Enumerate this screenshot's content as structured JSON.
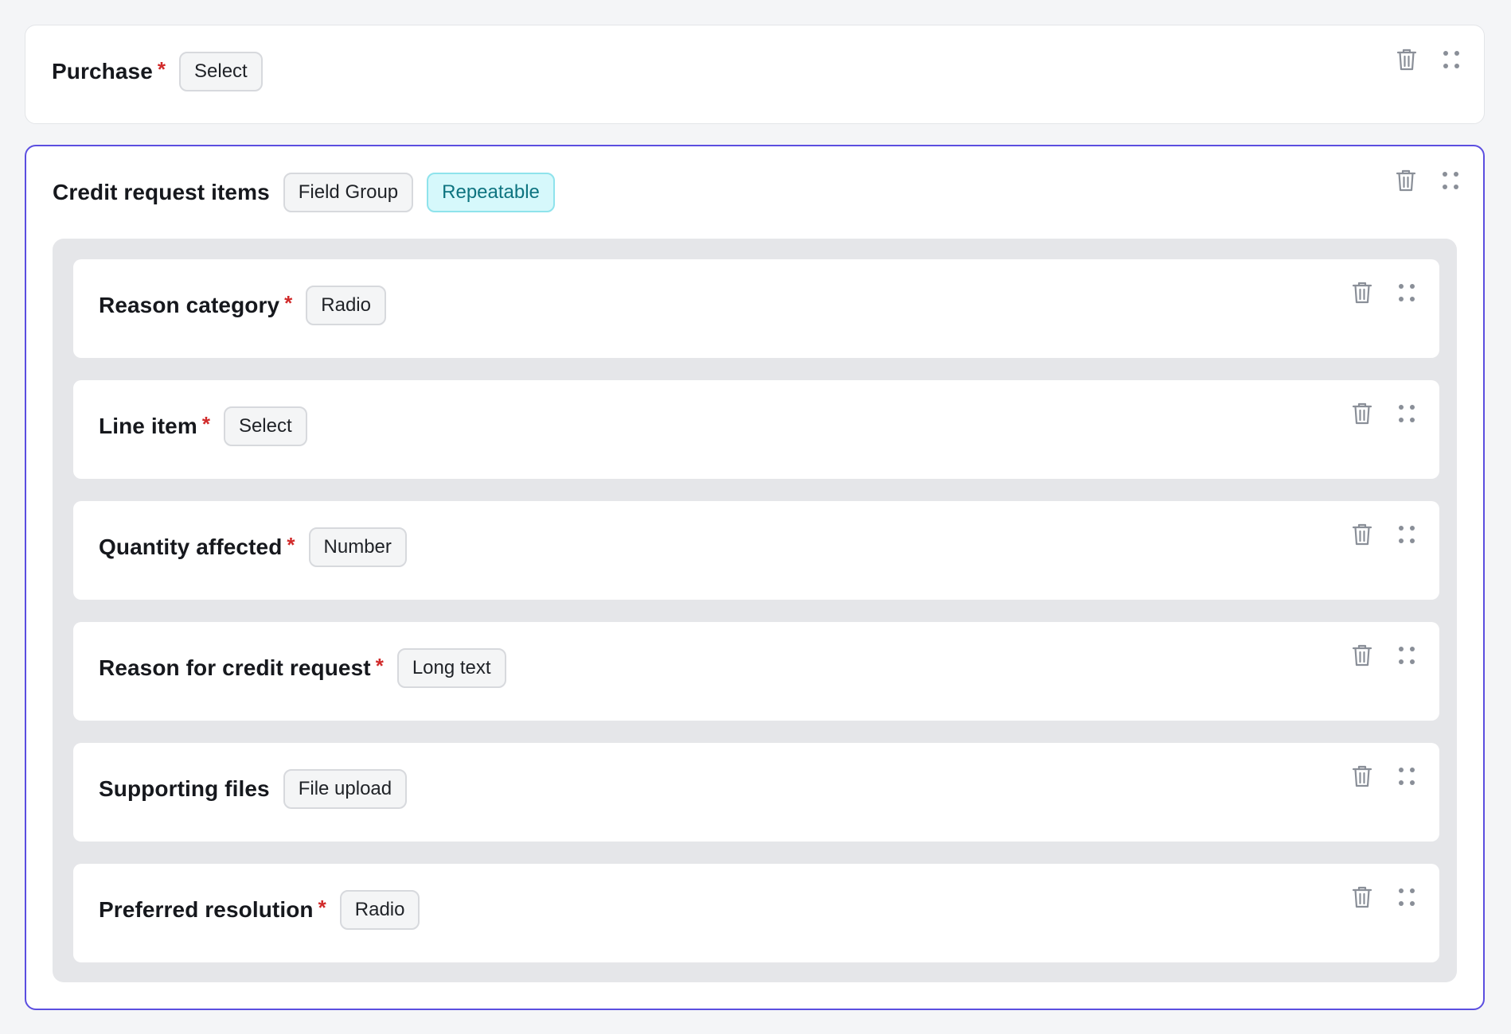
{
  "purchase": {
    "title": "Purchase",
    "required_mark": "*",
    "type_chip": "Select"
  },
  "group": {
    "title": "Credit request items",
    "type_chip": "Field Group",
    "repeat_chip": "Repeatable",
    "fields": [
      {
        "title": "Reason category",
        "required_mark": "*",
        "type_chip": "Radio"
      },
      {
        "title": "Line item",
        "required_mark": "*",
        "type_chip": "Select"
      },
      {
        "title": "Quantity affected",
        "required_mark": "*",
        "type_chip": "Number"
      },
      {
        "title": "Reason for credit request",
        "required_mark": "*",
        "type_chip": "Long text"
      },
      {
        "title": "Supporting files",
        "required_mark": "",
        "type_chip": "File upload"
      },
      {
        "title": "Preferred resolution",
        "required_mark": "*",
        "type_chip": "Radio"
      }
    ]
  },
  "icons": {
    "delete": "trash-icon",
    "drag": "drag-handle-icon"
  },
  "colors": {
    "required": "#d12a2a",
    "group_border": "#5b4ee0",
    "repeatable_bg": "#d6f8fb",
    "repeatable_text": "#0e7480",
    "icon": "#8a8f98"
  }
}
